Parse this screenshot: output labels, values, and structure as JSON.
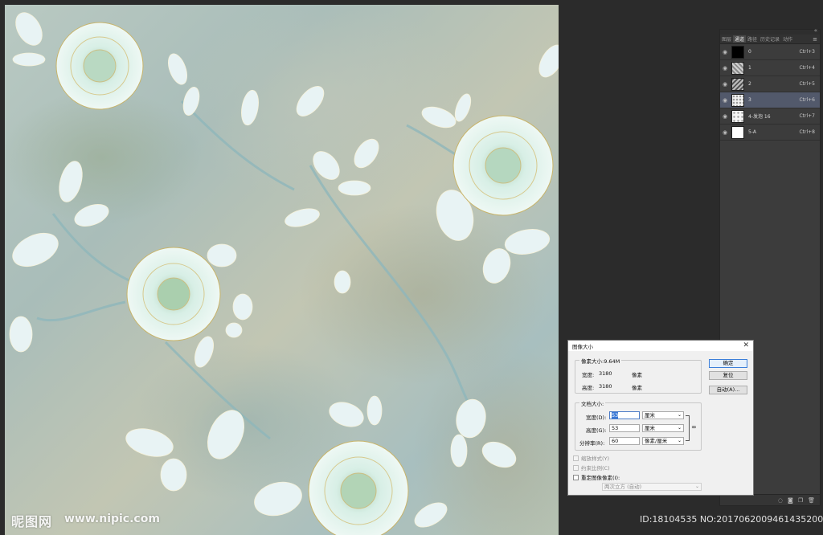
{
  "colors": {
    "workspace_bg": "#2b2b2b",
    "panel_bg": "#3c3c3c",
    "selected_row": "#52596b",
    "dialog_bg": "#f0f0f0",
    "flower": "#d9efe6",
    "flower_edge": "#c8b46a",
    "leaf": "#e6f1f3"
  },
  "panel": {
    "collapse_glyph": "«",
    "tabs": [
      {
        "label": "图层",
        "active": false
      },
      {
        "label": "通道",
        "active": true
      },
      {
        "label": "路径",
        "active": false
      },
      {
        "label": "历史记录",
        "active": false
      },
      {
        "label": "动作",
        "active": false
      }
    ],
    "menu_glyph": "≡",
    "channels": [
      {
        "name": "0",
        "shortcut": "Ctrl+3",
        "thumb": "black",
        "selected": false
      },
      {
        "name": "1",
        "shortcut": "Ctrl+4",
        "thumb": "pattern",
        "selected": false
      },
      {
        "name": "2",
        "shortcut": "Ctrl+5",
        "thumb": "pattern-dark",
        "selected": false
      },
      {
        "name": "3",
        "shortcut": "Ctrl+6",
        "thumb": "pattern-light",
        "selected": true
      },
      {
        "name": "4-发泡 16",
        "shortcut": "Ctrl+7",
        "thumb": "pattern-light",
        "selected": false
      },
      {
        "name": "5-A",
        "shortcut": "Ctrl+8",
        "thumb": "white",
        "selected": false
      }
    ],
    "bottom_icons": [
      "dotted-circle-icon",
      "mask-icon",
      "new-channel-icon",
      "trash-icon"
    ]
  },
  "dialog": {
    "title": "图像大小",
    "close_glyph": "✕",
    "pixel_size_label": "像素大小:9.64M",
    "width_label": "宽度:",
    "width_value": "3180",
    "height_label": "高度:",
    "height_value": "3180",
    "pixel_unit": "像素",
    "doc_size_label": "文档大小:",
    "doc_width_label": "宽度(D):",
    "doc_width_value": "53",
    "doc_height_label": "高度(G):",
    "doc_height_value": "53",
    "resolution_label": "分辨率(R):",
    "resolution_value": "60",
    "unit_cm": "厘米",
    "unit_res": "像素/厘米",
    "scale_styles": "缩放样式(Y)",
    "constrain": "约束比例(C)",
    "resample": "重定图像像素(I):",
    "resample_method": "两次立方 (自动)",
    "ok": "确定",
    "reset": "复位",
    "auto": "自动(A)..."
  },
  "watermark": {
    "logo": "昵图网",
    "url": "www.nipic.com",
    "id_text": "ID:18104535 NO:20170620094614352000"
  }
}
